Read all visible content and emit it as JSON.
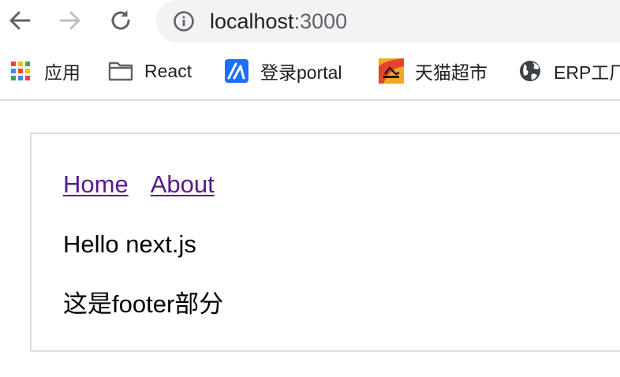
{
  "browser": {
    "url_host": "localhost",
    "url_port": ":3000",
    "icons": {
      "back": "arrow-left-icon",
      "forward": "arrow-right-icon",
      "reload": "reload-icon",
      "site_info": "info-icon"
    },
    "colors": {
      "toolbar_bg": "#ffffff",
      "omnibox_bg": "#f1f3f4",
      "icon_active": "#5f6368",
      "icon_disabled": "#bdc1c6"
    }
  },
  "bookmarks": [
    {
      "label": "应用",
      "icon": "apps-grid-icon"
    },
    {
      "label": "React",
      "icon": "folder-icon"
    },
    {
      "label": "登录portal",
      "icon": "portal-logo-icon"
    },
    {
      "label": "天猫超市",
      "icon": "tmall-logo-icon"
    },
    {
      "label": "ERP工厂",
      "icon": "globe-icon"
    }
  ],
  "page": {
    "nav": {
      "home": "Home",
      "about": "About"
    },
    "content": "Hello next.js",
    "footer": "这是footer部分",
    "colors": {
      "link": "#551a8b",
      "text": "#000000",
      "card_border": "#dddddd"
    }
  }
}
